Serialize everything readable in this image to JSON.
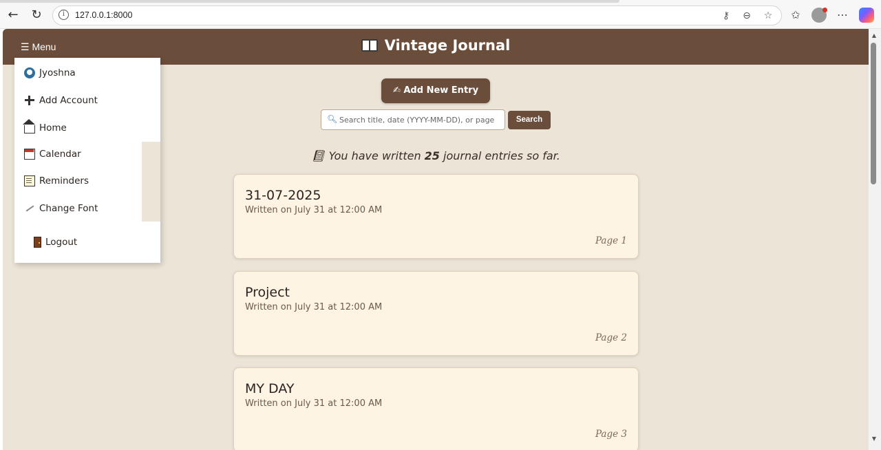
{
  "browser": {
    "url": "127.0.0.1:8000"
  },
  "header": {
    "menu_label": "☰ Menu",
    "title": "Vintage Journal"
  },
  "actions": {
    "add_entry_label": "✍ Add New Entry",
    "search_placeholder": "Search title, date (YYYY-MM-DD), or page",
    "search_button": "Search"
  },
  "summary": {
    "prefix": "You have written ",
    "count": "25",
    "suffix": " journal entries so far."
  },
  "menu": {
    "user": "Jyoshna",
    "add_account": "Add Account",
    "home": "Home",
    "calendar": "Calendar",
    "reminders": "Reminders",
    "change_font": "Change Font",
    "logout": "Logout"
  },
  "entries": [
    {
      "title": "31-07-2025",
      "subtitle": "Written on July 31 at 12:00 AM",
      "page": "Page 1"
    },
    {
      "title": "Project",
      "subtitle": "Written on July 31 at 12:00 AM",
      "page": "Page 2"
    },
    {
      "title": "MY DAY",
      "subtitle": "Written on July 31 at 12:00 AM",
      "page": "Page 3"
    }
  ],
  "colors": {
    "header": "#6b4d3b",
    "background": "#ebe4d7",
    "card": "#fdf4e3"
  }
}
